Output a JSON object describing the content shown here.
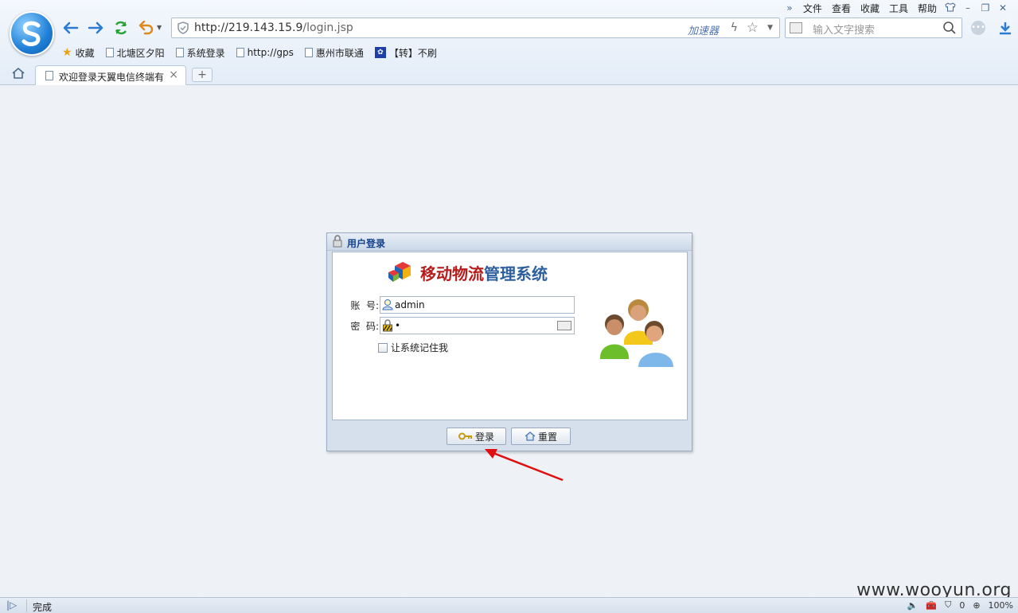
{
  "browser": {
    "menu": [
      "文件",
      "查看",
      "收藏",
      "工具",
      "帮助"
    ],
    "url_host": "http://219.143.15.9",
    "url_path": "/login.jsp",
    "accelerator": "加速器",
    "search_placeholder": "输入文字搜索",
    "favorites": [
      "收藏",
      "北塘区夕阳",
      "系统登录",
      "http://gps",
      "惠州市联通",
      "【转】不刷"
    ],
    "tab_title": "欢迎登录天翼电信终端有",
    "status_text": "完成",
    "status_count": "0",
    "zoom": "100%"
  },
  "login": {
    "panel_title": "用户登录",
    "brand_red": "移动物流",
    "brand_blue": "管理系统",
    "account_label": "账  号:",
    "account_value": "admin",
    "password_label": "密  码:",
    "password_value": "•",
    "remember_label": "让系统记住我",
    "login_button": "登录",
    "reset_button": "重置"
  },
  "watermark": "www.wooyun.org",
  "colors": {
    "panel_title": "#15428b",
    "brand_red": "#b71c1c",
    "brand_blue": "#2d5f9e",
    "arrow": "#e01010"
  }
}
